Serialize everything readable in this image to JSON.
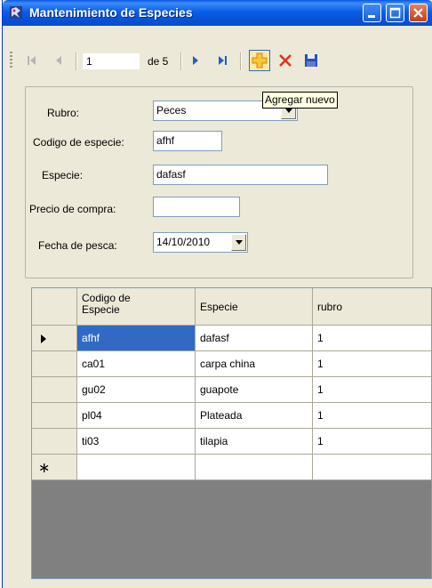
{
  "window": {
    "title": "Mantenimiento de Especies",
    "buttons": [
      "minimize",
      "maximize",
      "close"
    ]
  },
  "navigator": {
    "position": "1",
    "count_label": "de 5",
    "tooltip": "Agregar nuevo",
    "icons": [
      "move-first-icon",
      "move-previous-icon",
      "move-next-icon",
      "move-last-icon",
      "add-new-icon",
      "delete-icon",
      "save-icon"
    ]
  },
  "form": {
    "rubro_label": "Rubro:",
    "rubro_value": "Peces",
    "codigo_label": "Codigo de especie:",
    "codigo_value": "afhf",
    "especie_label": "Especie:",
    "especie_value": "dafasf",
    "precio_label": "Precio  de compra:",
    "precio_value": "",
    "fecha_label": "Fecha de pesca:",
    "fecha_value": "14/10/2010"
  },
  "grid": {
    "columns": [
      "Codigo de\nEspecie",
      "Especie",
      "rubro"
    ],
    "rows": [
      [
        "afhf",
        "dafasf",
        "1"
      ],
      [
        "ca01",
        "carpa china",
        "1"
      ],
      [
        "gu02",
        "guapote",
        "1"
      ],
      [
        "pl04",
        "Plateada",
        "1"
      ],
      [
        "ti03",
        "tilapia",
        "1"
      ]
    ],
    "selected_row": 0,
    "new_row_marker": "∗"
  },
  "colors": {
    "titlebar": "#0a5ee8",
    "selection": "#316ac5",
    "window_bg": "#ece9d8"
  }
}
